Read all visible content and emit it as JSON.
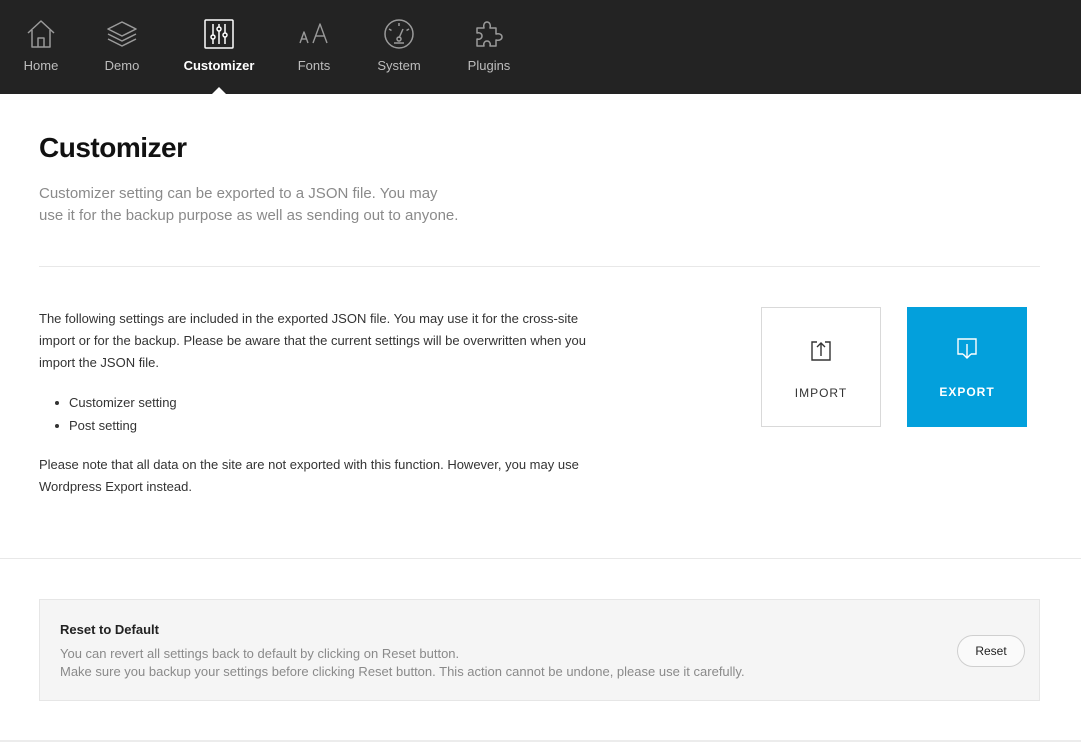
{
  "nav": {
    "items": [
      {
        "label": "Home",
        "icon": "home-icon"
      },
      {
        "label": "Demo",
        "icon": "layers-icon"
      },
      {
        "label": "Customizer",
        "icon": "sliders-icon",
        "active": true
      },
      {
        "label": "Fonts",
        "icon": "font-size-icon"
      },
      {
        "label": "System",
        "icon": "gauge-icon"
      },
      {
        "label": "Plugins",
        "icon": "puzzle-icon"
      }
    ]
  },
  "page": {
    "title": "Customizer",
    "intro_line1": "Customizer setting can be exported to a JSON file. You may",
    "intro_line2": "use it for the backup purpose as well as sending out to anyone."
  },
  "content": {
    "description": "The following settings are included in the exported JSON file. You may use it for the cross-site import or for the backup. Please be aware that the current settings will be overwritten when you import the JSON file.",
    "bullets": [
      "Customizer setting",
      "Post setting"
    ],
    "note": "Please note that all data on the site are not exported with this function. However, you may use Wordpress Export instead."
  },
  "actions": {
    "import_label": "IMPORT",
    "export_label": "EXPORT",
    "export_color": "#03a0dc"
  },
  "reset": {
    "title": "Reset to Default",
    "line1": "You can revert all settings back to default by clicking on Reset button.",
    "line2": "Make sure you backup your settings before clicking Reset button. This action cannot be undone, please use it carefully.",
    "button_label": "Reset"
  }
}
